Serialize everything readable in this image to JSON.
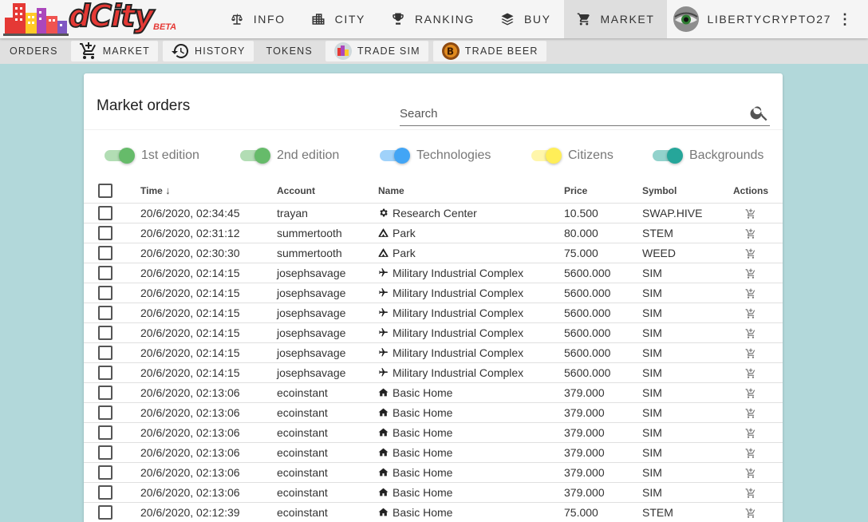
{
  "brand": {
    "logo_text": "dCity",
    "badge": "BETA"
  },
  "nav": {
    "items": [
      {
        "label": "INFO",
        "icon": "balance-scale-icon"
      },
      {
        "label": "CITY",
        "icon": "city-icon"
      },
      {
        "label": "RANKING",
        "icon": "trophy-icon"
      },
      {
        "label": "BUY",
        "icon": "layers-icon"
      },
      {
        "label": "MARKET",
        "icon": "cart-icon",
        "active": true
      }
    ],
    "user": "LIBERTYCRYPTO27"
  },
  "subnav": {
    "items": [
      {
        "label": "ORDERS"
      },
      {
        "label": "MARKET",
        "icon": "cart-plus-icon"
      },
      {
        "label": "HISTORY",
        "icon": "history-icon"
      },
      {
        "label": "TOKENS"
      },
      {
        "label": "TRADE SIM",
        "icon": "sim-token-icon"
      },
      {
        "label": "TRADE BEER",
        "icon": "beer-token-icon"
      }
    ]
  },
  "market": {
    "title": "Market orders",
    "search_placeholder": "Search",
    "filters": [
      {
        "label": "1st edition",
        "color": "#66bb6a"
      },
      {
        "label": "2nd edition",
        "color": "#66bb6a"
      },
      {
        "label": "Technologies",
        "color": "#42a5f5"
      },
      {
        "label": "Citizens",
        "color": "#ffee58"
      },
      {
        "label": "Backgrounds",
        "color": "#26a69a"
      }
    ],
    "columns": {
      "time": "Time",
      "account": "Account",
      "name": "Name",
      "price": "Price",
      "symbol": "Symbol",
      "actions": "Actions"
    },
    "rows": [
      {
        "time": "20/6/2020, 02:34:45",
        "account": "trayan",
        "icon": "gear-icon",
        "name": "Research Center",
        "price": "10.500",
        "symbol": "SWAP.HIVE"
      },
      {
        "time": "20/6/2020, 02:31:12",
        "account": "summertooth",
        "icon": "tent-icon",
        "name": "Park",
        "price": "80.000",
        "symbol": "STEM"
      },
      {
        "time": "20/6/2020, 02:30:30",
        "account": "summertooth",
        "icon": "tent-icon",
        "name": "Park",
        "price": "75.000",
        "symbol": "WEED"
      },
      {
        "time": "20/6/2020, 02:14:15",
        "account": "josephsavage",
        "icon": "plane-icon",
        "name": "Military Industrial Complex",
        "price": "5600.000",
        "symbol": "SIM"
      },
      {
        "time": "20/6/2020, 02:14:15",
        "account": "josephsavage",
        "icon": "plane-icon",
        "name": "Military Industrial Complex",
        "price": "5600.000",
        "symbol": "SIM"
      },
      {
        "time": "20/6/2020, 02:14:15",
        "account": "josephsavage",
        "icon": "plane-icon",
        "name": "Military Industrial Complex",
        "price": "5600.000",
        "symbol": "SIM"
      },
      {
        "time": "20/6/2020, 02:14:15",
        "account": "josephsavage",
        "icon": "plane-icon",
        "name": "Military Industrial Complex",
        "price": "5600.000",
        "symbol": "SIM"
      },
      {
        "time": "20/6/2020, 02:14:15",
        "account": "josephsavage",
        "icon": "plane-icon",
        "name": "Military Industrial Complex",
        "price": "5600.000",
        "symbol": "SIM"
      },
      {
        "time": "20/6/2020, 02:14:15",
        "account": "josephsavage",
        "icon": "plane-icon",
        "name": "Military Industrial Complex",
        "price": "5600.000",
        "symbol": "SIM"
      },
      {
        "time": "20/6/2020, 02:13:06",
        "account": "ecoinstant",
        "icon": "home-icon",
        "name": "Basic Home",
        "price": "379.000",
        "symbol": "SIM"
      },
      {
        "time": "20/6/2020, 02:13:06",
        "account": "ecoinstant",
        "icon": "home-icon",
        "name": "Basic Home",
        "price": "379.000",
        "symbol": "SIM"
      },
      {
        "time": "20/6/2020, 02:13:06",
        "account": "ecoinstant",
        "icon": "home-icon",
        "name": "Basic Home",
        "price": "379.000",
        "symbol": "SIM"
      },
      {
        "time": "20/6/2020, 02:13:06",
        "account": "ecoinstant",
        "icon": "home-icon",
        "name": "Basic Home",
        "price": "379.000",
        "symbol": "SIM"
      },
      {
        "time": "20/6/2020, 02:13:06",
        "account": "ecoinstant",
        "icon": "home-icon",
        "name": "Basic Home",
        "price": "379.000",
        "symbol": "SIM"
      },
      {
        "time": "20/6/2020, 02:13:06",
        "account": "ecoinstant",
        "icon": "home-icon",
        "name": "Basic Home",
        "price": "379.000",
        "symbol": "SIM"
      },
      {
        "time": "20/6/2020, 02:12:39",
        "account": "ecoinstant",
        "icon": "home-icon",
        "name": "Basic Home",
        "price": "75.000",
        "symbol": "STEM"
      }
    ]
  }
}
